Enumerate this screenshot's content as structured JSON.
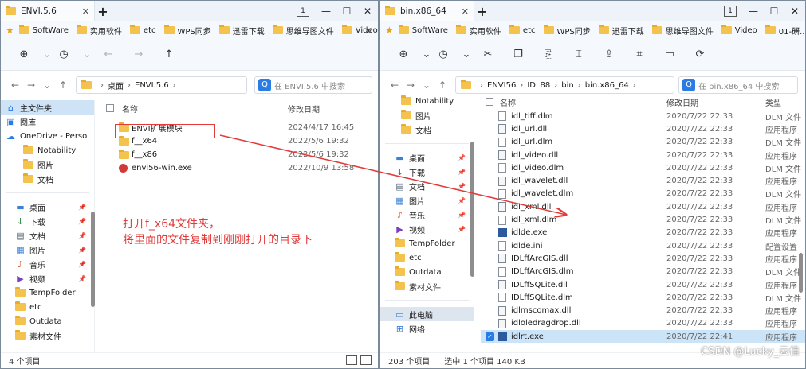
{
  "colors": {
    "accent": "#2a7be4",
    "annotation": "#e23b3b",
    "folder": "#f4c34e"
  },
  "left": {
    "tab_title": "ENVI.5.6",
    "tab_count": "1",
    "favorites": [
      "SoftWare",
      "实用软件",
      "etc",
      "WPS同步",
      "迅雷下载",
      "思维导图文件",
      "Video"
    ],
    "breadcrumb": [
      "桌面",
      "ENVI.5.6"
    ],
    "search_placeholder": "在 ENVI.5.6 中搜索",
    "sidebar": [
      {
        "label": "主文件夹",
        "icon": "home-icon"
      },
      {
        "label": "图库",
        "icon": "gallery-icon"
      },
      {
        "label": "OneDrive - Perso",
        "icon": "cloud-icon"
      },
      {
        "label": "Notability",
        "icon": "folder-icon"
      },
      {
        "label": "图片",
        "icon": "folder-icon"
      },
      {
        "label": "文档",
        "icon": "folder-icon"
      }
    ],
    "sidebar2": [
      {
        "label": "桌面",
        "icon": "desktop-icon"
      },
      {
        "label": "下载",
        "icon": "download-icon"
      },
      {
        "label": "文档",
        "icon": "documents-icon"
      },
      {
        "label": "图片",
        "icon": "pictures-icon"
      },
      {
        "label": "音乐",
        "icon": "music-icon"
      },
      {
        "label": "视频",
        "icon": "video-icon"
      },
      {
        "label": "TempFolder",
        "icon": "folder-icon"
      },
      {
        "label": "etc",
        "icon": "folder-icon"
      },
      {
        "label": "Outdata",
        "icon": "folder-icon"
      },
      {
        "label": "素材文件",
        "icon": "folder-icon"
      }
    ],
    "col_name": "名称",
    "col_date": "修改日期",
    "files": [
      {
        "name": "ENVI扩展模块",
        "date": "2024/4/17 16:45",
        "kind": "folder"
      },
      {
        "name": "f__x64",
        "date": "2022/5/6 19:32",
        "kind": "folder"
      },
      {
        "name": "f__x86",
        "date": "2022/5/6 19:32",
        "kind": "folder"
      },
      {
        "name": "envi56-win.exe",
        "date": "2022/10/9 13:58",
        "kind": "exe"
      }
    ],
    "status": "4 个项目"
  },
  "right": {
    "tab_title": "bin.x86_64",
    "tab_count": "1",
    "favorites": [
      "SoftWare",
      "实用软件",
      "etc",
      "WPS同步",
      "迅雷下载",
      "思维导图文件",
      "Video",
      "01-研..."
    ],
    "breadcrumb": [
      "ENVI56",
      "IDL88",
      "bin",
      "bin.x86_64"
    ],
    "search_placeholder": "在 bin.x86_64 中搜索",
    "sidebar": [
      {
        "label": "Notability",
        "icon": "folder-icon"
      },
      {
        "label": "图片",
        "icon": "folder-icon"
      },
      {
        "label": "文档",
        "icon": "folder-icon"
      }
    ],
    "sidebar2": [
      {
        "label": "桌面",
        "icon": "desktop-icon"
      },
      {
        "label": "下载",
        "icon": "download-icon"
      },
      {
        "label": "文档",
        "icon": "documents-icon"
      },
      {
        "label": "图片",
        "icon": "pictures-icon"
      },
      {
        "label": "音乐",
        "icon": "music-icon"
      },
      {
        "label": "视频",
        "icon": "video-icon"
      },
      {
        "label": "TempFolder",
        "icon": "folder-icon"
      },
      {
        "label": "etc",
        "icon": "folder-icon"
      },
      {
        "label": "Outdata",
        "icon": "folder-icon"
      },
      {
        "label": "素材文件",
        "icon": "folder-icon"
      }
    ],
    "sidebar3": [
      {
        "label": "此电脑",
        "icon": "computer-icon"
      },
      {
        "label": "网络",
        "icon": "network-icon"
      }
    ],
    "col_name": "名称",
    "col_date": "修改日期",
    "col_type": "类型",
    "files": [
      {
        "name": "idl_tiff.dlm",
        "date": "2020/7/22 22:33",
        "type": "DLM 文件",
        "kind": "dlm"
      },
      {
        "name": "idl_url.dll",
        "date": "2020/7/22 22:33",
        "type": "应用程序",
        "kind": "dll"
      },
      {
        "name": "idl_url.dlm",
        "date": "2020/7/22 22:33",
        "type": "DLM 文件",
        "kind": "dlm"
      },
      {
        "name": "idl_video.dll",
        "date": "2020/7/22 22:33",
        "type": "应用程序",
        "kind": "dll"
      },
      {
        "name": "idl_video.dlm",
        "date": "2020/7/22 22:33",
        "type": "DLM 文件",
        "kind": "dlm"
      },
      {
        "name": "idl_wavelet.dll",
        "date": "2020/7/22 22:33",
        "type": "应用程序",
        "kind": "dll"
      },
      {
        "name": "idl_wavelet.dlm",
        "date": "2020/7/22 22:33",
        "type": "DLM 文件",
        "kind": "dlm"
      },
      {
        "name": "idl_xml.dll",
        "date": "2020/7/22 22:33",
        "type": "应用程序",
        "kind": "dll"
      },
      {
        "name": "idl_xml.dlm",
        "date": "2020/7/22 22:33",
        "type": "DLM 文件",
        "kind": "dlm"
      },
      {
        "name": "idlde.exe",
        "date": "2020/7/22 22:33",
        "type": "应用程序",
        "kind": "exe"
      },
      {
        "name": "idlde.ini",
        "date": "2020/7/22 22:33",
        "type": "配置设置",
        "kind": "dlm"
      },
      {
        "name": "IDLffArcGIS.dll",
        "date": "2020/7/22 22:33",
        "type": "应用程序",
        "kind": "dll"
      },
      {
        "name": "IDLffArcGIS.dlm",
        "date": "2020/7/22 22:33",
        "type": "DLM 文件",
        "kind": "dlm"
      },
      {
        "name": "IDLffSQLite.dll",
        "date": "2020/7/22 22:33",
        "type": "应用程序",
        "kind": "dll"
      },
      {
        "name": "IDLffSQLite.dlm",
        "date": "2020/7/22 22:33",
        "type": "DLM 文件",
        "kind": "dlm"
      },
      {
        "name": "idlmscomax.dll",
        "date": "2020/7/22 22:33",
        "type": "应用程序",
        "kind": "dll"
      },
      {
        "name": "idloledragdrop.dll",
        "date": "2020/7/22 22:33",
        "type": "应用程序",
        "kind": "dll"
      },
      {
        "name": "idlrt.exe",
        "date": "2020/7/22 22:41",
        "type": "应用程序",
        "kind": "exe",
        "selected": true
      }
    ],
    "status_count": "203 个项目",
    "status_sel": "选中 1 个项目  140 KB"
  },
  "annotation": {
    "line1": "打开f_x64文件夹，",
    "line2": "将里面的文件复制到刚刚打开的目录下"
  },
  "watermark": "CSDN @Lucky_云佳"
}
